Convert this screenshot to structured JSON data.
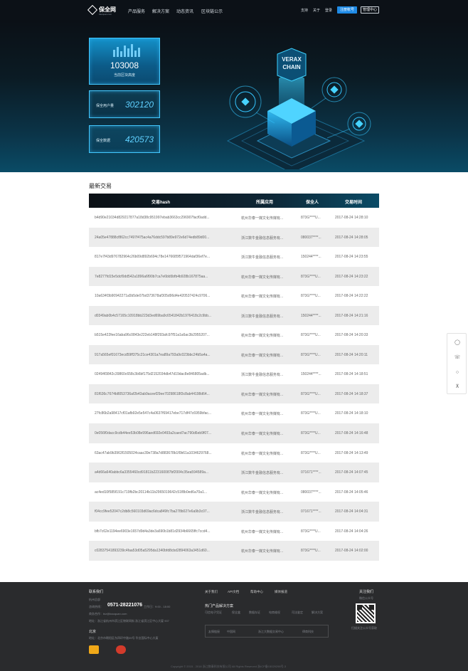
{
  "nav": {
    "logo_text": "保全网",
    "logo_sub": "baoquan.com",
    "items": [
      "产品服务",
      "解决方案",
      "动态资讯",
      "区块链公示"
    ],
    "utils": [
      "支持",
      "关于",
      "登录"
    ],
    "register_label": "注册帐号",
    "console_label": "管理中心"
  },
  "hero": {
    "block_height": "103008",
    "block_height_label": "当前区块高度",
    "users_label": "保全用户量",
    "users_value": "302120",
    "data_label": "保全数据",
    "data_value": "420573",
    "brand_line1": "VERAX",
    "brand_line2": "CHAIN"
  },
  "table": {
    "title": "最新交易",
    "headers": [
      "交易hash",
      "所属应用",
      "保全人",
      "交易时间"
    ],
    "rows": [
      {
        "hash": "b4d90e21034d829217877a18d38c951997ebab3663cc296907facf0add...",
        "app": "杭州华泰一媒文化传媒有...",
        "user": "873G****U...",
        "time": "2017-08-24 14:28:10"
      },
      {
        "hash": "24a05e47888cf862cc7497f475ac4a76ddc597b89e972e6d74edb89d00...",
        "app": "浙江数牛金融信息服务有...",
        "user": "080037****...",
        "time": "2017-08-24 14:28:05"
      },
      {
        "hash": "817e7f43d976782964c26b09d892b694c78e1476685f571964daf36ef7e...",
        "app": "浙江数牛金融信息服务有...",
        "user": "150244****...",
        "time": "2017-08-24 14:23:55"
      },
      {
        "hash": "7e8277fd15e5dcf0dd542a1896a6f90b7ca7e6bb5bfb4b928b167875aa...",
        "app": "杭州华泰一媒文化传媒有...",
        "user": "873G****U...",
        "time": "2017-08-24 14:23:22"
      },
      {
        "hash": "10a634f3b90942271a5b5de07bd373678af305d96d4e420537424c9706...",
        "app": "杭州华泰一媒文化传媒有...",
        "user": "873G****U...",
        "time": "2017-08-24 14:22:22"
      },
      {
        "hash": "d0349ab0b4c57165c10918bb223d3ed69ba9c6541842b1976418c2c9bb...",
        "app": "浙江数牛金融信息服务有...",
        "user": "150244****...",
        "time": "2017-08-24 14:21:16"
      },
      {
        "hash": "b515e422fee16aba96c0843e222eb148f293afc97f51a1a6ac3b2955207...",
        "app": "杭州华泰一媒文化传媒有...",
        "user": "873G****U...",
        "time": "2017-08-24 14:20:33"
      },
      {
        "hash": "917a565ef01673ecd59ff375c21ce4301a7ea89a793a9c023bbc24b5a4a...",
        "app": "杭州华泰一媒文化传媒有...",
        "user": "873G****U...",
        "time": "2017-08-24 14:20:11"
      },
      {
        "hash": "02494f3842c39860c658c3b6bf175d2152034db47d19dac8e846805adb...",
        "app": "浙江数牛金融信息服务有...",
        "user": "150244****...",
        "time": "2017-08-24 14:18:51"
      },
      {
        "hash": "81f636c7674b8053736af2b43ab9aceef29ee70298618f3c8ab44198d64...",
        "app": "杭州华泰一媒文化传媒有...",
        "user": "873G****U...",
        "time": "2017-08-24 14:18:37"
      },
      {
        "hash": "27fc86b2a98417cf01afb92e5e547c4a0637f69417ebe717df47c6959bfac...",
        "app": "杭州华泰一媒文化传媒有...",
        "user": "873G****U...",
        "time": "2017-08-24 14:18:10"
      },
      {
        "hash": "0e056f0dacc9cdb44ee53b08e996aed692e0493a2caed7ac790d6eb9f07...",
        "app": "杭州华泰一媒文化传媒有...",
        "user": "873G****U...",
        "time": "2017-08-24 14:16:48"
      },
      {
        "hash": "63ac47ab9b3963f1505024caac39e738a7d883678b1f0b61a1034629768...",
        "app": "杭州华泰一媒文化传媒有...",
        "user": "873G****U...",
        "time": "2017-08-24 14:13:49"
      },
      {
        "hash": "a4d66a640abbc6a3355460cd91811b223160087bf2004c35ea594589a...",
        "app": "浙江数牛金融信息服务有...",
        "user": "071671****...",
        "time": "2017-08-24 14:07:45"
      },
      {
        "hash": "ac4ed10f585f191c719fb2bc20114b11b2965019642c51f8b0ed6a70a1...",
        "app": "杭州华泰一媒文化传媒有...",
        "user": "080037****...",
        "time": "2017-08-24 14:05:46"
      },
      {
        "hash": "f04cc9fee52047c2db8c560103d69ac6dca849fc7ba278b027e6a9b3c07...",
        "app": "浙江数牛金融信息服务有...",
        "user": "071671****...",
        "time": "2017-08-24 14:04:31"
      },
      {
        "hash": "bfb7c62e1194ee6903e1657d9d4a3de3a690b1b81d2934b6665ffc7ccd4...",
        "app": "杭州华泰一媒文化传媒有...",
        "user": "873G****U...",
        "time": "2017-08-24 14:04:26"
      },
      {
        "hash": "c02837541893239c4faa53d05a5295da1340bfd8cbd2894063a3451d60...",
        "app": "杭州华泰一媒文化传媒有...",
        "user": "873G****U...",
        "time": "2017-08-24 14:02:00"
      }
    ]
  },
  "side": {
    "icons": [
      "qq-icon",
      "phone-icon",
      "wechat-icon",
      "back-to-top-icon"
    ]
  },
  "footer": {
    "contact_title": "联系我们",
    "hq": "杭州总部",
    "phone_label": "咨询热线：",
    "phone": "0571-28221076",
    "phone_hours": "工作日：9:00 - 18:00",
    "email": "商务合作：biz@baoquan.com",
    "address": "地址：浙江省杭州市滨江区物联网街 浙江省滨江区中心大厦 907",
    "branch_title": "北京",
    "branch_address": "地址：北京市朝阳区东四环中路39号 华业国际中心大厦",
    "links": [
      "关于我们",
      "API文档",
      "帮助中心",
      "媒体报道"
    ],
    "hot_title": "热门产品解决方案",
    "hot_items": [
      "可信电子凭证",
      "保全盒",
      "数据存证",
      "电商维权",
      "司法鉴定",
      "解决方案"
    ],
    "friend_label": "友情链接",
    "friends": [
      "中国网",
      "浙江大数据交易中心",
      "律商科技"
    ],
    "follow_title": "关注我们",
    "follow_sub": "微信公众号",
    "qr_caption": "扫描关注公众号获取",
    "copyright": "Copyright © 2015 - 2018    浙江数秦科技有限公司    All Rights Reserved  浙ICP备15029298号-3"
  }
}
